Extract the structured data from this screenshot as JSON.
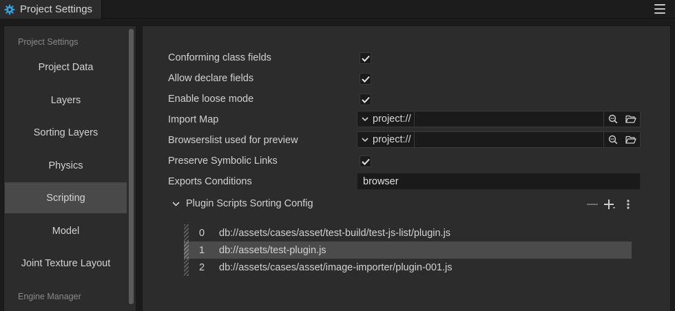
{
  "tab": {
    "title": "Project Settings"
  },
  "sidebar": {
    "section_project": "Project Settings",
    "items": [
      {
        "label": "Project Data"
      },
      {
        "label": "Layers"
      },
      {
        "label": "Sorting Layers"
      },
      {
        "label": "Physics"
      },
      {
        "label": "Scripting",
        "active": true
      },
      {
        "label": "Model"
      },
      {
        "label": "Joint Texture Layout"
      }
    ],
    "section_engine": "Engine Manager"
  },
  "settings": {
    "conforming_class_fields": {
      "label": "Conforming class fields",
      "checked": true
    },
    "allow_declare_fields": {
      "label": "Allow declare fields",
      "checked": true
    },
    "enable_loose_mode": {
      "label": "Enable loose mode",
      "checked": true
    },
    "import_map": {
      "label": "Import Map",
      "value": "project://"
    },
    "browserslist": {
      "label": "Browserslist used for preview",
      "value": "project://"
    },
    "preserve_symbolic_links": {
      "label": "Preserve Symbolic Links",
      "checked": true
    },
    "exports_conditions": {
      "label": "Exports Conditions",
      "value": "browser"
    }
  },
  "plugin_config": {
    "title": "Plugin Scripts Sorting Config",
    "rows": [
      {
        "index": "0",
        "path": "db://assets/cases/asset/test-build/test-js-list/plugin.js"
      },
      {
        "index": "1",
        "path": "db://assets/test-plugin.js",
        "selected": true
      },
      {
        "index": "2",
        "path": "db://assets/cases/asset/image-importer/plugin-001.js"
      }
    ]
  },
  "icons": {
    "tab": "gear-icon",
    "menu": "hamburger-menu-icon",
    "locate": "locate-asset-icon",
    "folder": "open-folder-icon",
    "remove": "minus-icon",
    "add": "plus-icon",
    "more": "more-vertical-icon"
  },
  "colors": {
    "accent": "#3a9fd8",
    "selected_row": "#4b4b4b",
    "active_nav": "#494949"
  }
}
